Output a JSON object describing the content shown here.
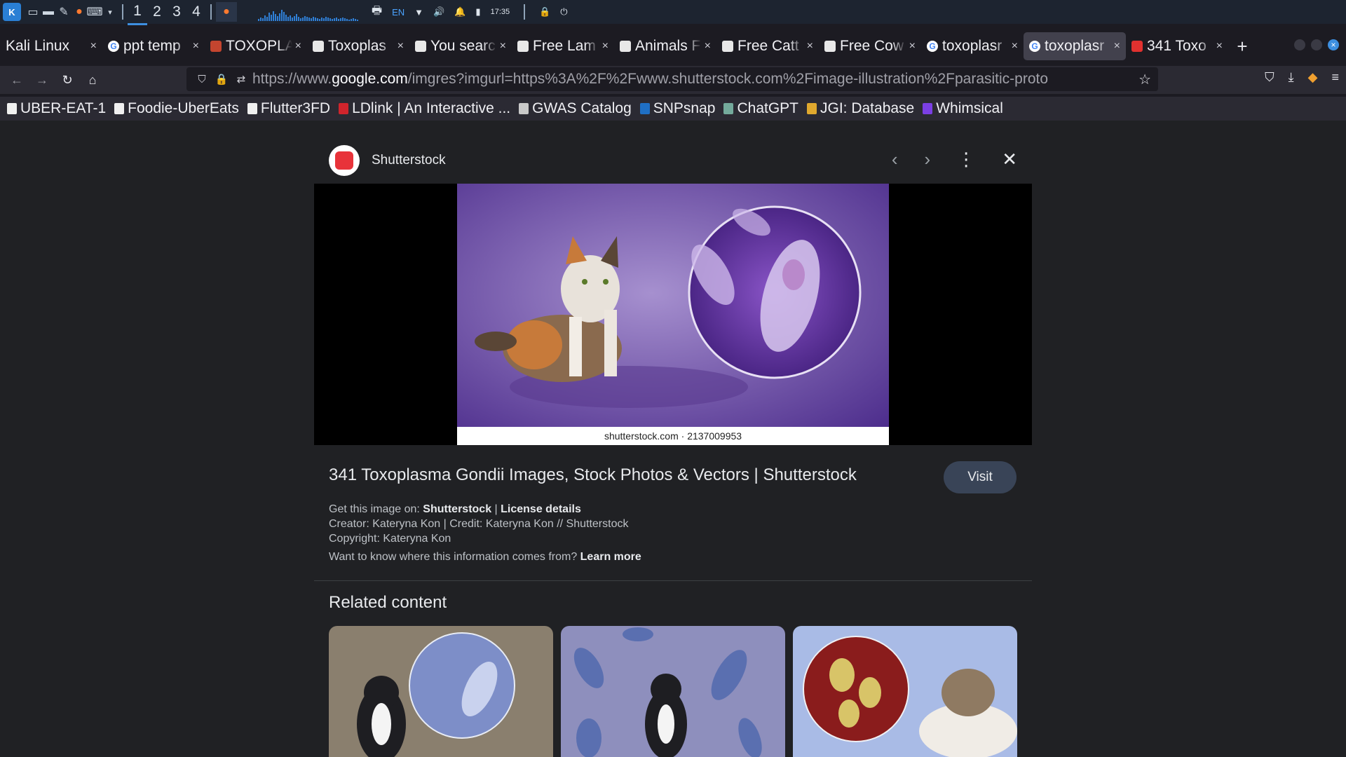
{
  "panel": {
    "workspaces": [
      "1",
      "2",
      "3",
      "4"
    ],
    "active_workspace": "1",
    "keyboard": "EN",
    "clock": "17:35"
  },
  "tabs": [
    {
      "label": "Kali Linux",
      "fav": "none"
    },
    {
      "label": "ppt temp",
      "fav": "g"
    },
    {
      "label": "TOXOPLA",
      "fav": "ppt"
    },
    {
      "label": "Toxoplas",
      "fav": "doc"
    },
    {
      "label": "You searc",
      "fav": "doc"
    },
    {
      "label": "Free Lam",
      "fav": "doc"
    },
    {
      "label": "Animals F",
      "fav": "doc"
    },
    {
      "label": "Free Catt",
      "fav": "doc"
    },
    {
      "label": "Free Cow",
      "fav": "doc"
    },
    {
      "label": "toxoplasr",
      "fav": "g"
    },
    {
      "label": "toxoplasr",
      "fav": "g",
      "active": true
    },
    {
      "label": "341 Toxo",
      "fav": "red"
    }
  ],
  "url": {
    "prefix": "https://www.",
    "host": "google.com",
    "path": "/imgres?imgurl=https%3A%2F%2Fwww.shutterstock.com%2Fimage-illustration%2Fparasitic-proto"
  },
  "bookmarks": [
    {
      "label": "UBER-EAT-1",
      "color": "#f0f0f0"
    },
    {
      "label": "Foodie-UberEats",
      "color": "#f0f0f0"
    },
    {
      "label": "Flutter3FD",
      "color": "#f0f0f0"
    },
    {
      "label": "LDlink | An Interactive ...",
      "color": "#d0242c"
    },
    {
      "label": "GWAS Catalog",
      "color": "#c9c9c9"
    },
    {
      "label": "SNPsnap",
      "color": "#1f6fc5"
    },
    {
      "label": "ChatGPT",
      "color": "#74aa9c"
    },
    {
      "label": "JGI: Database",
      "color": "#e0a82e"
    },
    {
      "label": "Whimsical",
      "color": "#7b3fe4"
    }
  ],
  "viewer": {
    "source": "Shutterstock",
    "watermark": "shutterstock.com · 2137009953",
    "title": "341 Toxoplasma Gondii Images, Stock Photos & Vectors | Shutterstock",
    "visit": "Visit",
    "get_prefix": "Get this image on: ",
    "get_source": "Shutterstock",
    "get_sep": " | ",
    "license": "License details",
    "creator": "Creator: Kateryna Kon | Credit: Kateryna Kon // Shutterstock",
    "copyright": "Copyright: Kateryna Kon",
    "want_prefix": "Want to know where this information comes from? ",
    "learn_more": "Learn more",
    "related": "Related content"
  }
}
